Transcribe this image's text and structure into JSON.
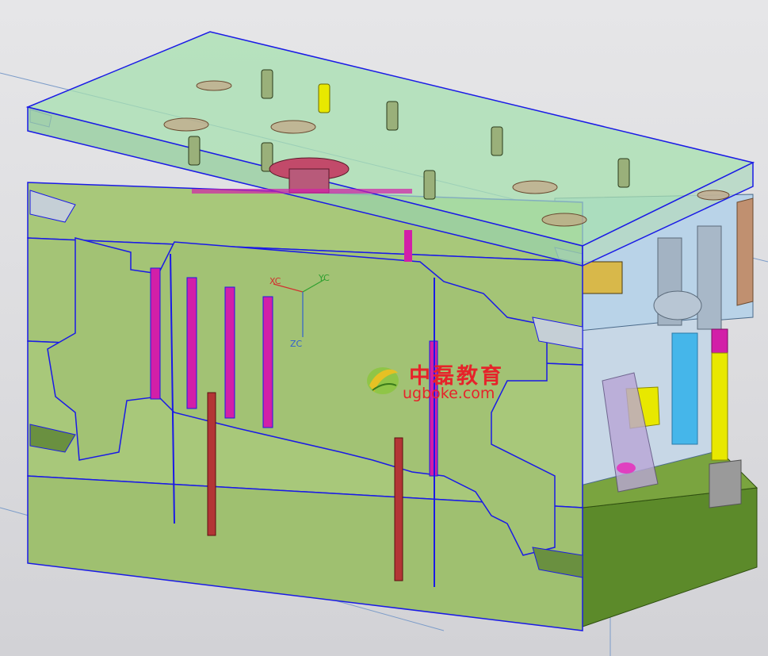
{
  "scene": {
    "kind": "CAD 3D mold assembly view",
    "colors": {
      "background": "#e0e0e3",
      "plate_green": "#a8c87a",
      "plate_dark_green": "#5f8a2e",
      "transparent_top": "#a7e0b0",
      "outline_blue": "#1a1ae6",
      "ejector_magenta": "#d21fa8",
      "pin_red": "#b33535",
      "yellow_part": "#e8e800",
      "cyan_part": "#45b6ea"
    }
  },
  "axes": {
    "x_label": "XC",
    "y_label": "YC",
    "z_label": "ZC"
  },
  "watermark": {
    "brand_cn": "中磊教育",
    "url": "ugboke.com",
    "color": "#e6232a",
    "logo_icon": "leaf-swirl-logo"
  }
}
